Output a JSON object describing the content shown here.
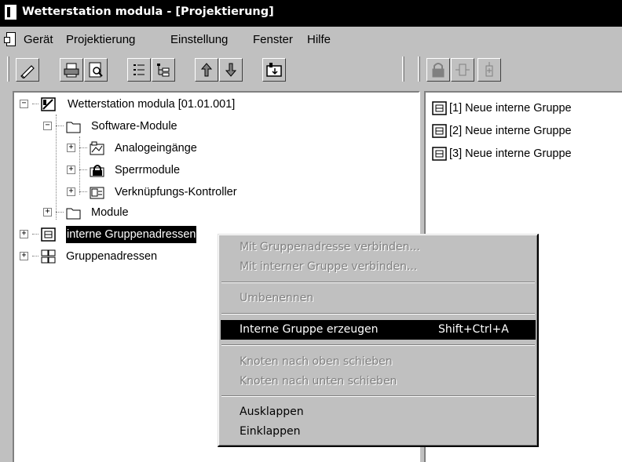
{
  "window": {
    "title": "Wetterstation modula  - [Projektierung]"
  },
  "menubar": {
    "items": [
      "Gerät",
      "Projektierung",
      "Einstellung",
      "Fenster",
      "Hilfe"
    ]
  },
  "toolbar": {
    "main_buttons": [
      "edit-icon",
      "print-icon",
      "print-preview-icon",
      "list-icon",
      "tree-list-icon",
      "arrow-up-icon",
      "arrow-down-icon",
      "download-icon"
    ],
    "side_buttons": [
      "lock-icon",
      "group-connect-icon",
      "group-add-icon"
    ]
  },
  "tree": {
    "root": "Wetterstation modula [01.01.001]",
    "software_modules": "Software-Module",
    "analog": "Analogeingänge",
    "sperr": "Sperrmodule",
    "verkn": "Verknüpfungs-Kontroller",
    "module": "Module",
    "internal_groups": "interne Gruppenadressen",
    "group_addresses": "Gruppenadressen"
  },
  "list": {
    "items": [
      "[1] Neue interne Gruppe",
      "[2] Neue interne Gruppe",
      "[3] Neue interne Gruppe"
    ]
  },
  "context_menu": {
    "connect_group": "Mit Gruppenadresse verbinden...",
    "connect_internal": "Mit interner Gruppe verbinden...",
    "rename": "Umbenennen",
    "create_group": "Interne Gruppe erzeugen",
    "create_group_shortcut": "Shift+Ctrl+A",
    "move_up": "Knoten nach oben schieben",
    "move_down": "Knoten nach unten schieben",
    "expand": "Ausklappen",
    "collapse": "Einklappen"
  }
}
